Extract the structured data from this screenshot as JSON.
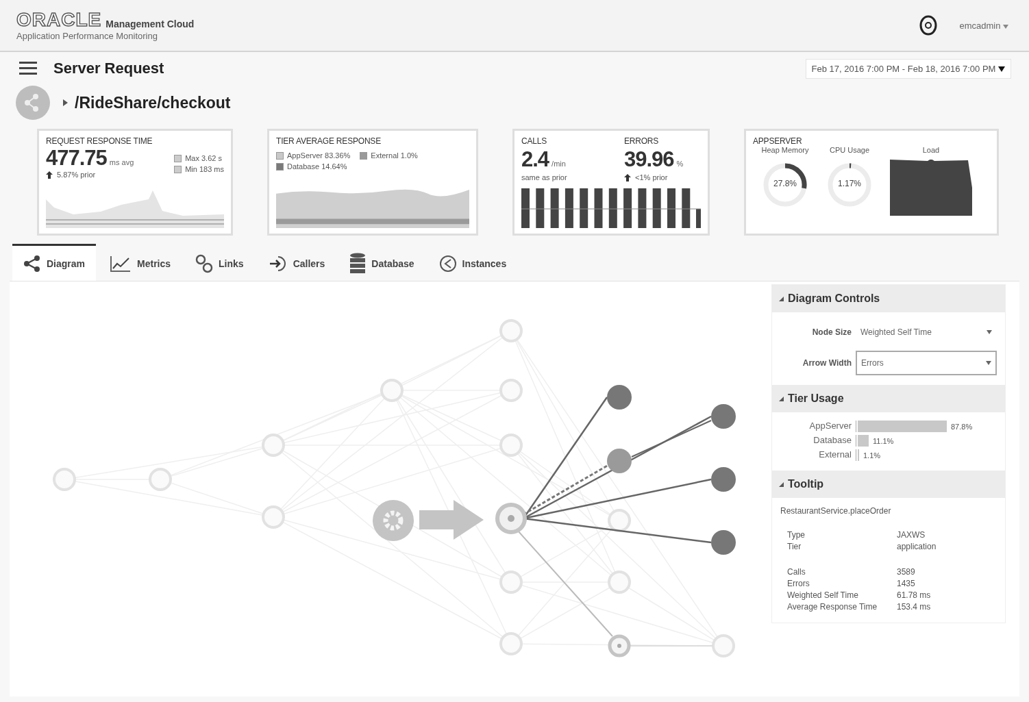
{
  "header": {
    "logo": "ORACLE",
    "product": "Management Cloud",
    "subtitle": "Application Performance Monitoring",
    "user": "emcadmin"
  },
  "page": {
    "title": "Server Request",
    "path": "/RideShare/checkout",
    "date_range": "Feb 17, 2016 7:00 PM - Feb 18, 2016 7:00 PM"
  },
  "response_card": {
    "title": "REQUEST RESPONSE TIME",
    "value": "477.75",
    "unit": "ms avg",
    "change": "5.87% prior",
    "stats": [
      "Max 3.62 s",
      "Min 183 ms"
    ]
  },
  "tier_card": {
    "title": "TIER AVERAGE RESPONSE",
    "legend": [
      {
        "label": "AppServer 83.36%",
        "color": "#c8c8c8"
      },
      {
        "label": "External 1.0%",
        "color": "#9a9a9a"
      },
      {
        "label": "Database 14.64%",
        "color": "#7a7a7a"
      }
    ]
  },
  "calls_card": {
    "metrics": [
      {
        "title": "CALLS",
        "value": "2.4",
        "unit": "/min",
        "note": "same as prior",
        "arrow": false
      },
      {
        "title": "ERRORS",
        "value": "39.96",
        "unit": "%",
        "note": "<1% prior",
        "arrow": true
      }
    ]
  },
  "appserver_card": {
    "title": "APPSERVER",
    "gauges": [
      {
        "label": "Heap Memory",
        "reading": "27.8%"
      },
      {
        "label": "CPU Usage",
        "reading": "1.17%"
      }
    ],
    "load_label": "Load"
  },
  "tabs": [
    {
      "label": "Diagram",
      "selected": true
    },
    {
      "label": "Metrics",
      "selected": false
    },
    {
      "label": "Links",
      "selected": false
    },
    {
      "label": "Callers",
      "selected": false
    },
    {
      "label": "Database",
      "selected": false
    },
    {
      "label": "Instances",
      "selected": false
    }
  ],
  "diagram_controls": {
    "title": "Diagram Controls",
    "fields": [
      {
        "label": "Node Size",
        "value": "Weighted Self Time",
        "focused": false
      },
      {
        "label": "Arrow Width",
        "value": "Errors",
        "focused": true
      }
    ]
  },
  "tier_usage": {
    "title": "Tier Usage",
    "rows": [
      {
        "label": "AppServer",
        "reading": "87.8%"
      },
      {
        "label": "Database",
        "reading": "11.1%"
      },
      {
        "label": "External",
        "reading": "1.1%"
      }
    ]
  },
  "tooltip": {
    "title": "Tooltip",
    "name": "RestaurantService.placeOrder",
    "groups": [
      [
        {
          "label": "Type",
          "value": "JAXWS"
        },
        {
          "label": "Tier",
          "value": "application"
        }
      ],
      [
        {
          "label": "Calls",
          "value": "3589"
        },
        {
          "label": "Errors",
          "value": "1435"
        },
        {
          "label": "Weighted Self Time",
          "value": "61.78 ms"
        },
        {
          "label": "Average Response Time",
          "value": "153.4 ms"
        }
      ]
    ]
  }
}
